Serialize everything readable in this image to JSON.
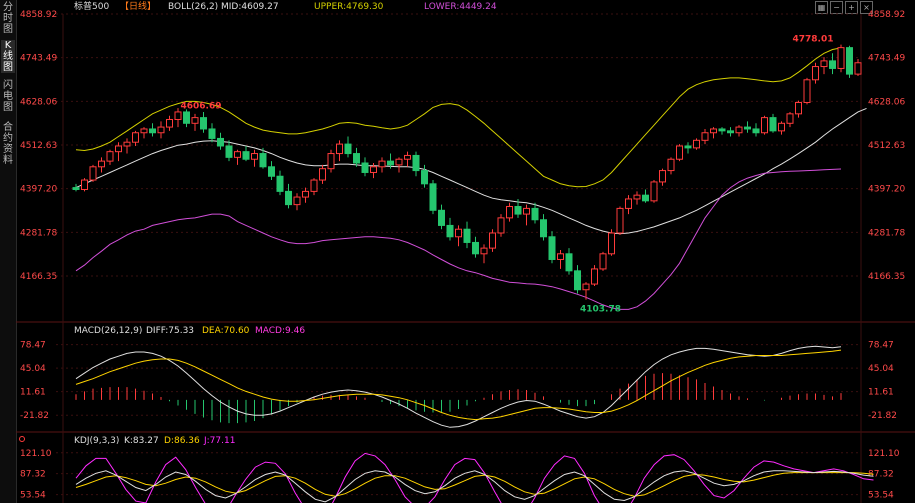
{
  "sidebar": {
    "tabs": [
      "分时图",
      "K线图",
      "闪电图",
      "合约资料"
    ],
    "active": 1
  },
  "main_header": {
    "symbol": "标普500",
    "period": "【日线】",
    "indicator": "BOLL(26,2)",
    "mid": "MID:4609.27",
    "upper": "UPPER:4769.30",
    "lower": "LOWER:4449.24"
  },
  "macd_header": {
    "name": "MACD(26,12,9)",
    "diff": "DIFF:75.33",
    "dea": "DEA:70.60",
    "macd": "MACD:9.46"
  },
  "kdj_header": {
    "name": "KDJ(9,3,3)",
    "k": "K:83.27",
    "d": "D:86.36",
    "j": "J:77.11"
  },
  "toolbar_icons": [
    "grid-icon",
    "minus-icon",
    "plus-icon",
    "close-icon"
  ],
  "colors": {
    "up": "#ff3b3b",
    "down": "#25c66e",
    "mid": "#e0e0e0",
    "upper": "#d4d000",
    "lower": "#d14fd8",
    "axis_label": "#ff4a4a",
    "dea": "#ffd400",
    "macd": "#ff3be0",
    "j": "#ff2bff",
    "grid": "#3a0f0f"
  },
  "chart_data": {
    "type": "candlestick",
    "price_axis": [
      4858.92,
      4743.49,
      4628.06,
      4512.63,
      4397.2,
      4281.78,
      4166.35
    ],
    "price_range": [
      4050,
      4858.92
    ],
    "annotations": {
      "high": "4606.69",
      "low": "4103.78",
      "last_high": "4778.01"
    },
    "candles": [
      [
        4400,
        4410,
        4390,
        4395
      ],
      [
        4395,
        4425,
        4390,
        4420
      ],
      [
        4420,
        4460,
        4415,
        4455
      ],
      [
        4455,
        4480,
        4440,
        4470
      ],
      [
        4470,
        4500,
        4460,
        4495
      ],
      [
        4495,
        4520,
        4470,
        4510
      ],
      [
        4510,
        4530,
        4490,
        4520
      ],
      [
        4520,
        4550,
        4510,
        4545
      ],
      [
        4545,
        4560,
        4530,
        4555
      ],
      [
        4555,
        4570,
        4535,
        4545
      ],
      [
        4545,
        4575,
        4530,
        4560
      ],
      [
        4560,
        4590,
        4550,
        4580
      ],
      [
        4580,
        4610,
        4560,
        4600
      ],
      [
        4600,
        4606.69,
        4560,
        4570
      ],
      [
        4570,
        4595,
        4550,
        4585
      ],
      [
        4585,
        4600,
        4545,
        4555
      ],
      [
        4555,
        4570,
        4520,
        4530
      ],
      [
        4530,
        4545,
        4500,
        4510
      ],
      [
        4510,
        4525,
        4470,
        4480
      ],
      [
        4480,
        4500,
        4460,
        4495
      ],
      [
        4495,
        4510,
        4470,
        4475
      ],
      [
        4475,
        4500,
        4455,
        4490
      ],
      [
        4490,
        4505,
        4450,
        4455
      ],
      [
        4455,
        4470,
        4420,
        4430
      ],
      [
        4430,
        4445,
        4380,
        4390
      ],
      [
        4390,
        4410,
        4345,
        4355
      ],
      [
        4355,
        4385,
        4340,
        4375
      ],
      [
        4375,
        4400,
        4360,
        4390
      ],
      [
        4390,
        4425,
        4380,
        4420
      ],
      [
        4420,
        4460,
        4410,
        4450
      ],
      [
        4450,
        4500,
        4440,
        4490
      ],
      [
        4490,
        4525,
        4470,
        4515
      ],
      [
        4515,
        4535,
        4480,
        4490
      ],
      [
        4490,
        4505,
        4455,
        4465
      ],
      [
        4465,
        4480,
        4430,
        4440
      ],
      [
        4440,
        4465,
        4425,
        4455
      ],
      [
        4455,
        4480,
        4440,
        4470
      ],
      [
        4470,
        4490,
        4450,
        4460
      ],
      [
        4460,
        4480,
        4440,
        4475
      ],
      [
        4475,
        4495,
        4455,
        4485
      ],
      [
        4485,
        4495,
        4430,
        4445
      ],
      [
        4445,
        4460,
        4400,
        4410
      ],
      [
        4410,
        4420,
        4330,
        4340
      ],
      [
        4340,
        4355,
        4290,
        4300
      ],
      [
        4300,
        4320,
        4260,
        4270
      ],
      [
        4270,
        4300,
        4245,
        4290
      ],
      [
        4290,
        4310,
        4240,
        4255
      ],
      [
        4255,
        4270,
        4215,
        4225
      ],
      [
        4225,
        4250,
        4200,
        4240
      ],
      [
        4240,
        4290,
        4230,
        4280
      ],
      [
        4280,
        4330,
        4270,
        4320
      ],
      [
        4320,
        4360,
        4310,
        4350
      ],
      [
        4350,
        4370,
        4320,
        4330
      ],
      [
        4330,
        4355,
        4300,
        4345
      ],
      [
        4345,
        4360,
        4305,
        4315
      ],
      [
        4315,
        4330,
        4260,
        4270
      ],
      [
        4270,
        4285,
        4200,
        4210
      ],
      [
        4210,
        4235,
        4185,
        4225
      ],
      [
        4225,
        4240,
        4170,
        4180
      ],
      [
        4180,
        4195,
        4120,
        4130
      ],
      [
        4130,
        4150,
        4103.78,
        4145
      ],
      [
        4145,
        4195,
        4140,
        4185
      ],
      [
        4185,
        4230,
        4180,
        4225
      ],
      [
        4225,
        4290,
        4220,
        4280
      ],
      [
        4280,
        4350,
        4275,
        4345
      ],
      [
        4345,
        4380,
        4330,
        4370
      ],
      [
        4370,
        4390,
        4355,
        4380
      ],
      [
        4380,
        4395,
        4360,
        4365
      ],
      [
        4365,
        4420,
        4360,
        4415
      ],
      [
        4415,
        4450,
        4405,
        4445
      ],
      [
        4445,
        4480,
        4435,
        4475
      ],
      [
        4475,
        4515,
        4470,
        4510
      ],
      [
        4510,
        4520,
        4490,
        4505
      ],
      [
        4505,
        4530,
        4500,
        4525
      ],
      [
        4525,
        4555,
        4515,
        4545
      ],
      [
        4545,
        4560,
        4530,
        4555
      ],
      [
        4555,
        4560,
        4540,
        4550
      ],
      [
        4550,
        4560,
        4535,
        4545
      ],
      [
        4545,
        4565,
        4535,
        4560
      ],
      [
        4560,
        4575,
        4545,
        4555
      ],
      [
        4555,
        4570,
        4535,
        4545
      ],
      [
        4545,
        4590,
        4540,
        4585
      ],
      [
        4585,
        4595,
        4545,
        4550
      ],
      [
        4550,
        4575,
        4540,
        4570
      ],
      [
        4570,
        4600,
        4560,
        4595
      ],
      [
        4595,
        4630,
        4585,
        4625
      ],
      [
        4625,
        4690,
        4620,
        4685
      ],
      [
        4685,
        4730,
        4675,
        4720
      ],
      [
        4720,
        4745,
        4700,
        4735
      ],
      [
        4735,
        4755,
        4700,
        4715
      ],
      [
        4715,
        4778.01,
        4705,
        4770
      ],
      [
        4770,
        4775,
        4690,
        4700
      ],
      [
        4700,
        4740,
        4695,
        4730
      ]
    ],
    "mid": [
      4400,
      4410,
      4420,
      4430,
      4440,
      4450,
      4460,
      4470,
      4480,
      4490,
      4498,
      4505,
      4512,
      4515,
      4520,
      4523,
      4524,
      4522,
      4520,
      4515,
      4510,
      4505,
      4498,
      4490,
      4480,
      4472,
      4465,
      4460,
      4458,
      4458,
      4460,
      4462,
      4462,
      4460,
      4458,
      4458,
      4457,
      4456,
      4455,
      4455,
      4453,
      4448,
      4440,
      4430,
      4420,
      4410,
      4400,
      4390,
      4380,
      4372,
      4368,
      4365,
      4362,
      4360,
      4355,
      4348,
      4340,
      4330,
      4320,
      4310,
      4300,
      4292,
      4285,
      4280,
      4278,
      4280,
      4284,
      4290,
      4296,
      4304,
      4312,
      4320,
      4330,
      4340,
      4352,
      4364,
      4376,
      4388,
      4400,
      4412,
      4424,
      4436,
      4450,
      4462,
      4476,
      4490,
      4505,
      4520,
      4538,
      4555,
      4570,
      4585,
      4600,
      4609.27
    ],
    "upper": [
      4500,
      4498,
      4502,
      4510,
      4520,
      4535,
      4550,
      4565,
      4580,
      4595,
      4605,
      4615,
      4622,
      4628,
      4628,
      4625,
      4620,
      4612,
      4600,
      4585,
      4570,
      4560,
      4552,
      4548,
      4545,
      4542,
      4542,
      4545,
      4550,
      4555,
      4562,
      4570,
      4572,
      4570,
      4565,
      4562,
      4558,
      4555,
      4558,
      4565,
      4580,
      4595,
      4612,
      4620,
      4622,
      4618,
      4605,
      4588,
      4570,
      4550,
      4530,
      4510,
      4490,
      4470,
      4450,
      4430,
      4420,
      4410,
      4405,
      4402,
      4403,
      4410,
      4420,
      4440,
      4465,
      4490,
      4515,
      4540,
      4565,
      4590,
      4615,
      4640,
      4660,
      4672,
      4680,
      4685,
      4688,
      4690,
      4690,
      4688,
      4685,
      4682,
      4680,
      4682,
      4690,
      4705,
      4722,
      4740,
      4755,
      4765,
      4769.3
    ],
    "lower": [
      4180,
      4195,
      4215,
      4232,
      4250,
      4262,
      4275,
      4285,
      4290,
      4300,
      4305,
      4310,
      4315,
      4318,
      4320,
      4325,
      4330,
      4330,
      4325,
      4310,
      4300,
      4290,
      4280,
      4270,
      4262,
      4255,
      4252,
      4252,
      4255,
      4260,
      4262,
      4264,
      4266,
      4268,
      4270,
      4270,
      4268,
      4266,
      4262,
      4255,
      4245,
      4235,
      4222,
      4210,
      4198,
      4188,
      4180,
      4175,
      4168,
      4160,
      4155,
      4150,
      4148,
      4146,
      4145,
      4142,
      4138,
      4132,
      4125,
      4118,
      4110,
      4100,
      4090,
      4082,
      4078,
      4078,
      4085,
      4100,
      4120,
      4145,
      4170,
      4200,
      4240,
      4280,
      4320,
      4350,
      4380,
      4400,
      4415,
      4425,
      4432,
      4438,
      4440,
      4442,
      4443,
      4444,
      4445,
      4446,
      4447,
      4448,
      4449.24
    ],
    "macd": {
      "axis": [
        78.47,
        45.04,
        11.61,
        -21.82
      ],
      "range": [
        -40,
        85
      ],
      "diff": [
        30,
        38,
        46,
        52,
        58,
        62,
        66,
        68,
        68,
        66,
        62,
        56,
        48,
        38,
        27,
        16,
        6,
        -3,
        -10,
        -16,
        -20,
        -22,
        -22,
        -20,
        -16,
        -11,
        -6,
        -1,
        4,
        8,
        11,
        13,
        14,
        13,
        11,
        8,
        4,
        -1,
        -6,
        -12,
        -19,
        -25,
        -31,
        -36,
        -39,
        -38,
        -35,
        -30,
        -24,
        -18,
        -12,
        -7,
        -3,
        -1,
        -2,
        -6,
        -11,
        -16,
        -20,
        -24,
        -26,
        -24,
        -18,
        -8,
        4,
        16,
        28,
        40,
        50,
        58,
        64,
        68,
        71,
        73,
        73,
        72,
        70,
        68,
        66,
        64,
        63,
        62,
        63,
        66,
        70,
        73,
        75,
        76,
        75,
        74,
        75.33
      ],
      "dea": [
        22,
        26,
        30,
        35,
        40,
        44,
        48,
        52,
        55,
        57,
        58,
        58,
        56,
        52,
        47,
        41,
        35,
        29,
        23,
        17,
        12,
        8,
        4,
        1,
        -1,
        -2,
        -2,
        -1,
        0,
        2,
        4,
        6,
        7,
        8,
        8,
        8,
        7,
        5,
        3,
        0,
        -4,
        -8,
        -13,
        -18,
        -22,
        -25,
        -27,
        -28,
        -27,
        -26,
        -24,
        -21,
        -18,
        -15,
        -12,
        -11,
        -11,
        -12,
        -13,
        -15,
        -17,
        -18,
        -18,
        -16,
        -12,
        -7,
        -1,
        6,
        13,
        20,
        27,
        33,
        39,
        44,
        49,
        53,
        56,
        59,
        61,
        62,
        63,
        63,
        63,
        63,
        64,
        65,
        66,
        67,
        68,
        69,
        70.6
      ],
      "bar": [
        8,
        12,
        16,
        17,
        18,
        18,
        18,
        16,
        13,
        9,
        4,
        -2,
        -8,
        -14,
        -20,
        -25,
        -29,
        -32,
        -33,
        -33,
        -32,
        -30,
        -26,
        -21,
        -15,
        -9,
        -4,
        0,
        4,
        6,
        7,
        7,
        7,
        5,
        3,
        0,
        -3,
        -6,
        -9,
        -12,
        -15,
        -17,
        -18,
        -18,
        -17,
        -13,
        -8,
        -2,
        3,
        8,
        12,
        14,
        15,
        14,
        10,
        5,
        0,
        -4,
        -7,
        -9,
        -9,
        -6,
        0,
        8,
        16,
        23,
        29,
        34,
        37,
        38,
        37,
        35,
        32,
        29,
        24,
        19,
        14,
        9,
        5,
        2,
        0,
        -1,
        0,
        3,
        6,
        8,
        9,
        9,
        7,
        5,
        9.46
      ]
    },
    "kdj": {
      "axis": [
        121.1,
        87.32,
        53.54
      ],
      "range": [
        40,
        132
      ],
      "k": [
        70,
        80,
        88,
        92,
        85,
        75,
        65,
        60,
        70,
        82,
        90,
        86,
        75,
        62,
        52,
        48,
        55,
        66,
        78,
        86,
        90,
        85,
        72,
        58,
        46,
        42,
        50,
        64,
        78,
        88,
        92,
        90,
        82,
        70,
        60,
        55,
        58,
        68,
        80,
        88,
        92,
        86,
        74,
        60,
        50,
        46,
        52,
        64,
        76,
        86,
        90,
        84,
        70,
        56,
        46,
        44,
        50,
        62,
        74,
        84,
        90,
        92,
        88,
        80,
        72,
        68,
        70,
        76,
        84,
        90,
        92,
        92,
        91,
        90,
        89,
        90,
        91,
        90,
        88,
        85,
        83.27
      ],
      "d": [
        65,
        70,
        76,
        82,
        84,
        81,
        76,
        70,
        68,
        72,
        78,
        82,
        80,
        74,
        66,
        59,
        56,
        60,
        68,
        76,
        83,
        84,
        80,
        72,
        62,
        54,
        51,
        55,
        63,
        72,
        80,
        84,
        84,
        80,
        73,
        66,
        62,
        63,
        69,
        76,
        83,
        85,
        82,
        75,
        66,
        58,
        54,
        56,
        63,
        71,
        79,
        82,
        79,
        71,
        62,
        55,
        51,
        53,
        60,
        68,
        76,
        83,
        86,
        85,
        82,
        78,
        75,
        74,
        77,
        81,
        85,
        88,
        89,
        89,
        89,
        89,
        89,
        89,
        89,
        88,
        86.36
      ],
      "j": [
        80,
        100,
        112,
        112,
        88,
        62,
        43,
        40,
        74,
        102,
        114,
        94,
        65,
        38,
        24,
        26,
        53,
        78,
        98,
        106,
        104,
        87,
        56,
        30,
        14,
        18,
        48,
        82,
        108,
        120,
        116,
        102,
        78,
        50,
        34,
        33,
        50,
        78,
        102,
        112,
        110,
        88,
        58,
        30,
        18,
        22,
        48,
        80,
        102,
        116,
        112,
        88,
        52,
        26,
        14,
        22,
        48,
        80,
        102,
        116,
        118,
        110,
        92,
        70,
        52,
        48,
        60,
        80,
        98,
        108,
        106,
        100,
        95,
        92,
        89,
        92,
        95,
        92,
        86,
        79,
        77.11
      ]
    }
  }
}
